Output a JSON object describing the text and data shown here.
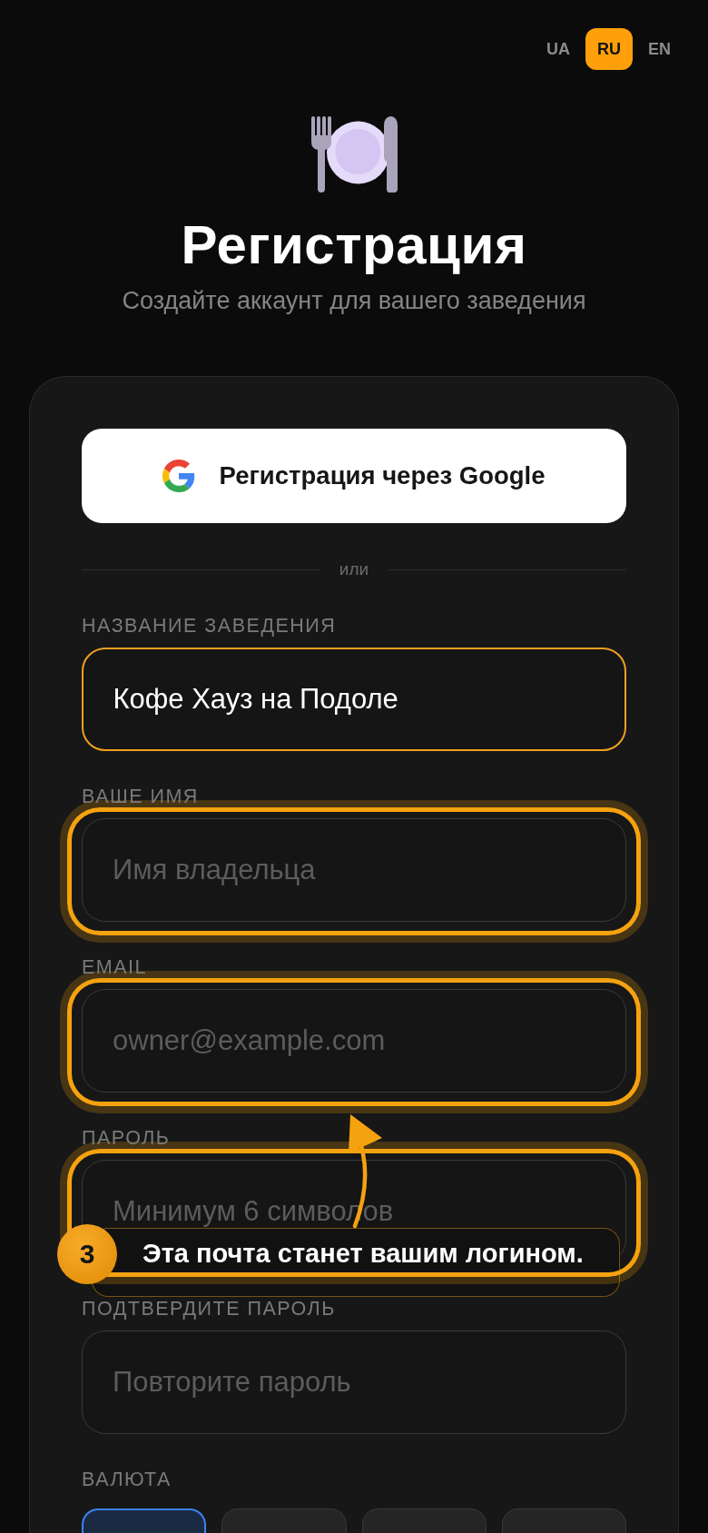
{
  "language_switcher": [
    {
      "label": "UA",
      "selected": false
    },
    {
      "label": "RU",
      "selected": true
    },
    {
      "label": "EN",
      "selected": false
    }
  ],
  "header": {
    "title": "Регистрация",
    "subtitle": "Создайте аккаунт для вашего заведения"
  },
  "form": {
    "google_button": "Регистрация через Google",
    "divider": "или",
    "fields": [
      {
        "label": "НАЗВАНИЕ ЗАВЕДЕНИЯ",
        "value": "Кофе Хауз на Подоле",
        "focused": true,
        "highlighted": false
      },
      {
        "label": "ВАШЕ ИМЯ",
        "placeholder": "Имя владельца",
        "focused": false,
        "highlighted": true
      },
      {
        "label": "EMAIL",
        "placeholder": "owner@example.com",
        "focused": false,
        "highlighted": true
      },
      {
        "label": "ПАРОЛЬ",
        "placeholder": "Минимум 6 символов",
        "focused": false,
        "highlighted": true
      },
      {
        "label": "ПОДТВЕРДИТЕ ПАРОЛЬ",
        "placeholder": "Повторите пароль",
        "focused": false,
        "highlighted": false
      }
    ],
    "currency": {
      "label": "ВАЛЮТА",
      "options": [
        {
          "selected": true
        },
        {
          "selected": false
        },
        {
          "selected": false
        },
        {
          "selected": false
        }
      ]
    }
  },
  "tour_tooltip": {
    "step": "3",
    "text": "Эта почта станет вашим логином."
  }
}
